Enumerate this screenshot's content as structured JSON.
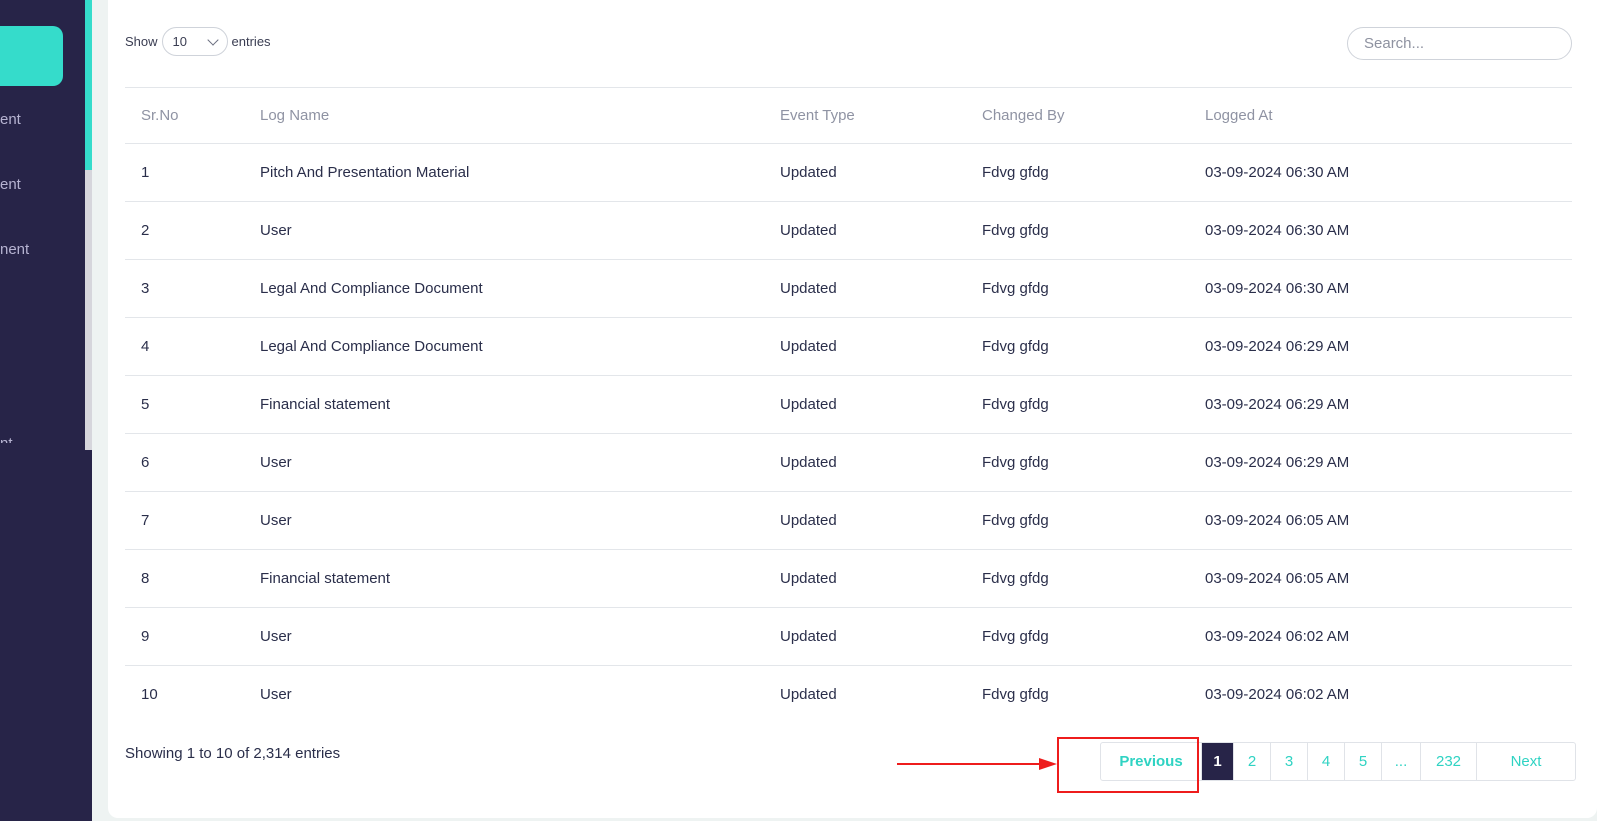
{
  "sidebar": {
    "items": [
      {
        "label": "ent"
      },
      {
        "label": "ent"
      },
      {
        "label": "nent"
      },
      {
        "label": "nt"
      }
    ]
  },
  "toolbar": {
    "show_label": "Show",
    "entries_value": "10",
    "entries_label": "entries",
    "search_placeholder": "Search..."
  },
  "table": {
    "headers": [
      "Sr.No",
      "Log Name",
      "Event Type",
      "Changed By",
      "Logged At"
    ],
    "rows": [
      [
        "1",
        "Pitch And Presentation Material",
        "Updated",
        "Fdvg gfdg",
        "03-09-2024 06:30 AM"
      ],
      [
        "2",
        "User",
        "Updated",
        "Fdvg gfdg",
        "03-09-2024 06:30 AM"
      ],
      [
        "3",
        "Legal And Compliance Document",
        "Updated",
        "Fdvg gfdg",
        "03-09-2024 06:30 AM"
      ],
      [
        "4",
        "Legal And Compliance Document",
        "Updated",
        "Fdvg gfdg",
        "03-09-2024 06:29 AM"
      ],
      [
        "5",
        "Financial statement",
        "Updated",
        "Fdvg gfdg",
        "03-09-2024 06:29 AM"
      ],
      [
        "6",
        "User",
        "Updated",
        "Fdvg gfdg",
        "03-09-2024 06:29 AM"
      ],
      [
        "7",
        "User",
        "Updated",
        "Fdvg gfdg",
        "03-09-2024 06:05 AM"
      ],
      [
        "8",
        "Financial statement",
        "Updated",
        "Fdvg gfdg",
        "03-09-2024 06:05 AM"
      ],
      [
        "9",
        "User",
        "Updated",
        "Fdvg gfdg",
        "03-09-2024 06:02 AM"
      ],
      [
        "10",
        "User",
        "Updated",
        "Fdvg gfdg",
        "03-09-2024 06:02 AM"
      ]
    ]
  },
  "footer": {
    "info": "Showing 1 to 10 of 2,314 entries"
  },
  "pagination": {
    "previous": "Previous",
    "pages": [
      "1",
      "2",
      "3",
      "4",
      "5"
    ],
    "ellipsis": "...",
    "last": "232",
    "next": "Next",
    "active_page": "1"
  },
  "colors": {
    "sidebar_bg": "#272448",
    "accent": "#35dccb",
    "annotation": "#ee1c1c"
  },
  "icons": {
    "select_chevron": "chevron-down-icon",
    "annotation_arrow": "arrow-right-icon"
  }
}
